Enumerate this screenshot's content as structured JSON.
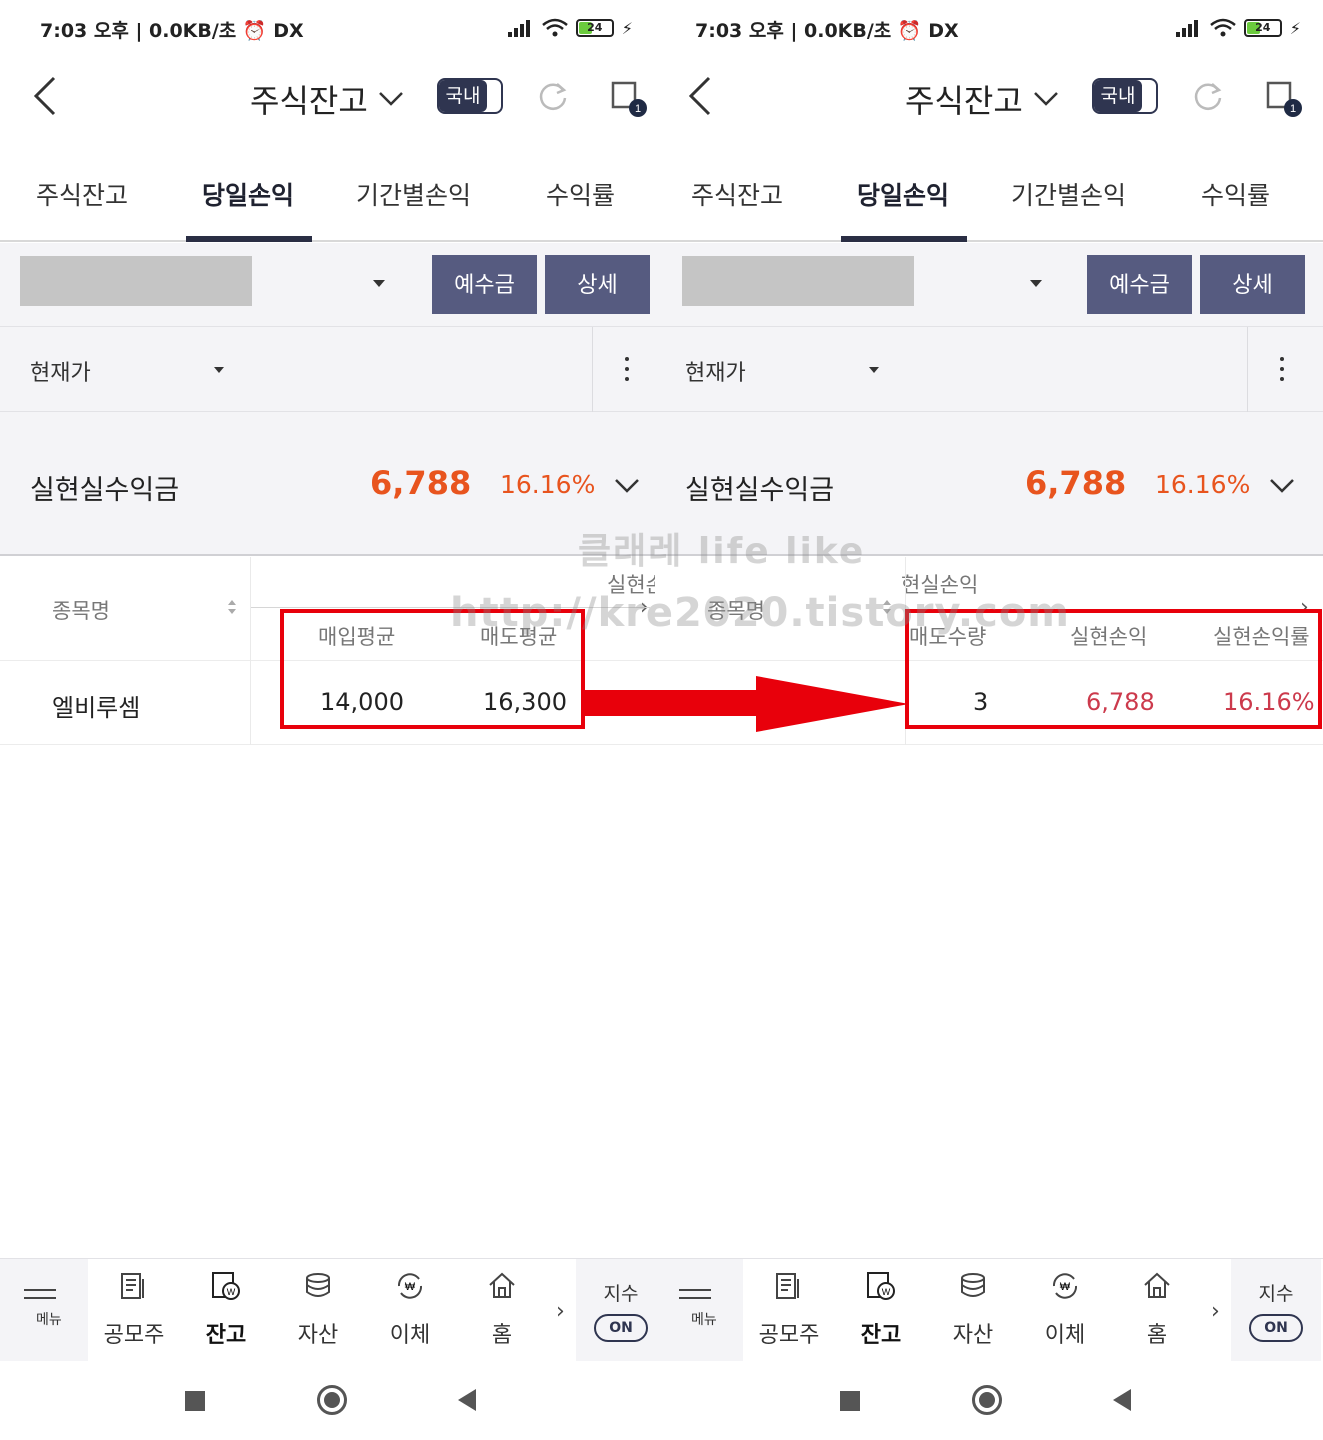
{
  "status": {
    "time": "7:03 오후 | 0.0KB/초",
    "alarm_icon": "alarm-icon",
    "dx_label": "DX",
    "battery": "24"
  },
  "header": {
    "title": "주식잔고",
    "market_toggle": "국내",
    "window_count": "1"
  },
  "tabs": [
    {
      "label": "주식잔고"
    },
    {
      "label": "당일손익"
    },
    {
      "label": "기간별손익"
    },
    {
      "label": "수익률"
    }
  ],
  "account": {
    "deposit_button": "예수금",
    "detail_button": "상세"
  },
  "price_selector": {
    "label": "현재가"
  },
  "summary": {
    "label": "실현실수익금",
    "amount": "6,788",
    "rate": "16.16%"
  },
  "left_table": {
    "headers": {
      "stock_name": "종목명",
      "top_clipped": "실현손",
      "buy_avg": "매입평균",
      "sell_avg": "매도평균"
    },
    "row": {
      "name": "엘비루셈",
      "buy_avg": "14,000",
      "sell_avg": "16,300"
    }
  },
  "right_table": {
    "headers": {
      "stock_name": "종목명",
      "top_clipped": "현실손익",
      "sell_qty": "매도수량",
      "realized_pl": "실현손익",
      "realized_rate": "실현손익률"
    },
    "row": {
      "sell_qty": "3",
      "realized_pl": "6,788",
      "realized_rate": "16.16%"
    }
  },
  "bottom_nav": {
    "menu": "메뉴",
    "items": [
      {
        "label": "공모주",
        "icon": "ipo-icon"
      },
      {
        "label": "잔고",
        "icon": "balance-icon"
      },
      {
        "label": "자산",
        "icon": "assets-icon"
      },
      {
        "label": "이체",
        "icon": "transfer-icon"
      },
      {
        "label": "홈",
        "icon": "home-icon"
      }
    ],
    "index_label": "지수",
    "index_toggle": "ON"
  },
  "watermark": {
    "line1": "클래레 life like",
    "line2": "http://kre2020.tistory.com"
  },
  "colors": {
    "accent_navy": "#2f3550",
    "button": "#565b80",
    "profit_orange": "#e8541e",
    "profit_red": "#cc3a4c",
    "highlight": "#e8000b"
  }
}
